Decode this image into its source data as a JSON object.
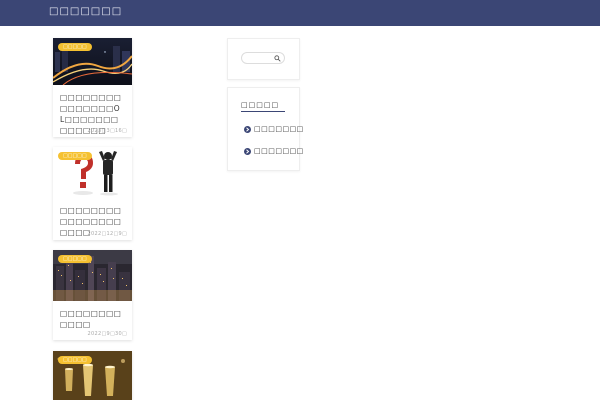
{
  "header": {
    "site_title": "□□□□□□□",
    "background": "#3b4675"
  },
  "posts": [
    {
      "category": "□□□□□",
      "title": "□□□□□□□□□□□□□□□OL□□□□□□□□□□□□□",
      "date": "2023□3□16□",
      "thumb": "city-highway-night"
    },
    {
      "category": "□□□□□",
      "title": "□□□□□□□□□□□□□□□□□□□□",
      "date": "2022□12□9□",
      "thumb": "question-mark-figure"
    },
    {
      "category": "□□□□□",
      "title": "□□□□□□□□□□□□",
      "date": "2022□9□30□",
      "thumb": "city-night-view"
    },
    {
      "category": "□□□□□",
      "title": "",
      "date": "",
      "thumb": "champagne-glasses"
    }
  ],
  "sidebar": {
    "search": {
      "placeholder": "",
      "icon": "search-icon"
    },
    "categories": {
      "title": "□□□□□",
      "items": [
        {
          "label": "□□□□□□□",
          "icon": "chevron-right-circle-icon"
        },
        {
          "label": "□□□□□□□",
          "icon": "chevron-right-circle-icon"
        }
      ]
    }
  },
  "colors": {
    "accent": "#3b4675",
    "badge": "#f5c131"
  }
}
